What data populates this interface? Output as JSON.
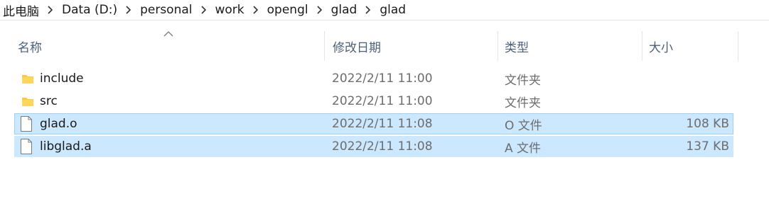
{
  "breadcrumb": [
    "此电脑",
    "Data (D:)",
    "personal",
    "work",
    "opengl",
    "glad",
    "glad"
  ],
  "columns": {
    "name": "名称",
    "date": "修改日期",
    "type": "类型",
    "size": "大小"
  },
  "sort": {
    "column": "name",
    "direction": "ascending"
  },
  "rows": [
    {
      "name": "include",
      "date": "2022/2/11 11:00",
      "type": "文件夹",
      "size": "",
      "icon": "folder-icon",
      "selected": false
    },
    {
      "name": "src",
      "date": "2022/2/11 11:00",
      "type": "文件夹",
      "size": "",
      "icon": "folder-icon",
      "selected": false
    },
    {
      "name": "glad.o",
      "date": "2022/2/11 11:08",
      "type": "O 文件",
      "size": "108 KB",
      "icon": "file-icon",
      "selected": true
    },
    {
      "name": "libglad.a",
      "date": "2022/2/11 11:08",
      "type": "A 文件",
      "size": "137 KB",
      "icon": "file-icon",
      "selected": true
    }
  ],
  "colors": {
    "selection": "#cce8ff",
    "selection_border": "#99d1ff",
    "header_text": "#4c607a",
    "folder": "#ffc83d"
  }
}
